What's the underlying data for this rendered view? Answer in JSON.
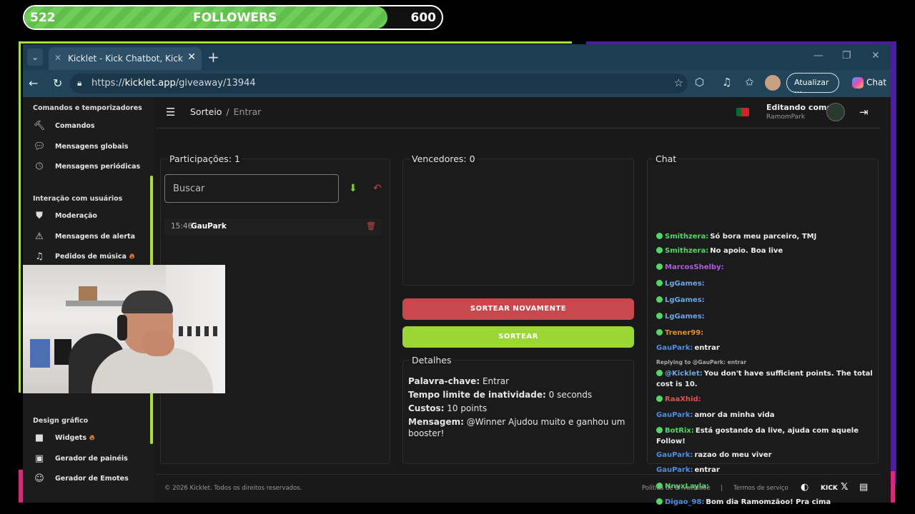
{
  "overlay": {
    "followers_current": "522",
    "followers_label": "FOLLOWERS",
    "followers_goal": "600",
    "followers_progress": 0.87
  },
  "browser": {
    "tab_title": "Kicklet - Kick Chatbot, Kick Widgets",
    "url_prefix": "https://",
    "url_host": "kicklet.app",
    "url_path": "/giveaway/13944",
    "update_label": "Atualizar",
    "chat_label": "Chat"
  },
  "sidebar": {
    "section1": "Comandos e temporizadores",
    "items1": [
      "Comandos",
      "Mensagens globais",
      "Mensagens periódicas"
    ],
    "section2": "Interação com usuários",
    "items2": [
      "Moderação",
      "Mensagens de alerta",
      "Pedidos de música"
    ],
    "section3": "Design gráfico",
    "items3": [
      "Widgets",
      "Gerador de painéis",
      "Gerador de Emotes"
    ]
  },
  "header": {
    "crumb_root": "Sorteio",
    "crumb_current": "Entrar",
    "editing_label": "Editando como",
    "editing_user": "RamomPark"
  },
  "participants": {
    "title": "Participações: 1",
    "search_placeholder": "Buscar",
    "entries": [
      {
        "time": "15:46",
        "name": "GauPark"
      }
    ]
  },
  "winners": {
    "title": "Vencedores: 0",
    "redraw_label": "SORTEAR NOVAMENTE",
    "draw_label": "SORTEAR"
  },
  "details": {
    "title": "Detalhes",
    "keyword_label": "Palavra-chave:",
    "keyword_value": "Entrar",
    "timeout_label": "Tempo limite de inatividade:",
    "timeout_value": "0 seconds",
    "cost_label": "Custos:",
    "cost_value": "10 points",
    "message_label": "Mensagem:",
    "message_value": "@Winner Ajudou muito e ganhou um booster!"
  },
  "chat": {
    "title": "Chat",
    "messages": [
      {
        "user": "Smithzera:",
        "text": "Só bora meu parceiro, TMJ",
        "color": "#53d769"
      },
      {
        "user": "Smithzera:",
        "text": "No apoio. Boa live",
        "color": "#53d769"
      },
      {
        "user": "MarcosShelby:",
        "text": "",
        "color": "#b05ee0"
      },
      {
        "user": "LgGames:",
        "text": "",
        "color": "#6aa7e8"
      },
      {
        "user": "LgGames:",
        "text": "",
        "color": "#6aa7e8"
      },
      {
        "user": "LgGames:",
        "text": "",
        "color": "#6aa7e8"
      },
      {
        "user": "Trener99:",
        "text": "",
        "color": "#e0902a"
      },
      {
        "user": "GauPark:",
        "text": "entrar",
        "color": "#4a8fe0"
      },
      {
        "user": "@Kicklet:",
        "text": "You don't have sufficient points. The total cost is 10.",
        "color": "#6aa7e8"
      },
      {
        "user": "RaaXhid:",
        "text": "",
        "color": "#e05353"
      },
      {
        "user": "GauPark:",
        "text": "amor da minha vida",
        "color": "#4a8fe0"
      },
      {
        "user": "BotRix:",
        "text": "Está gostando da live, ajuda com aquele Follow!",
        "color": "#53d769"
      },
      {
        "user": "GauPark:",
        "text": "razao do meu viver",
        "color": "#4a8fe0"
      },
      {
        "user": "GauPark:",
        "text": "entrar",
        "color": "#4a8fe0"
      },
      {
        "user": "NnyxLayla:",
        "text": "",
        "color": "#53d769"
      },
      {
        "user": "Digao_98:",
        "text": "Bom dia Ramomzãoo! Pra cima",
        "color": "#4a8fe0"
      }
    ],
    "reply_note": "Replying to @GauPark: entrar"
  },
  "footer": {
    "copyright": "© 2026 Kicklet. Todos os direitos reservados.",
    "privacy": "Política de Privacidade",
    "terms": "Termos de serviço",
    "sep": "|"
  }
}
